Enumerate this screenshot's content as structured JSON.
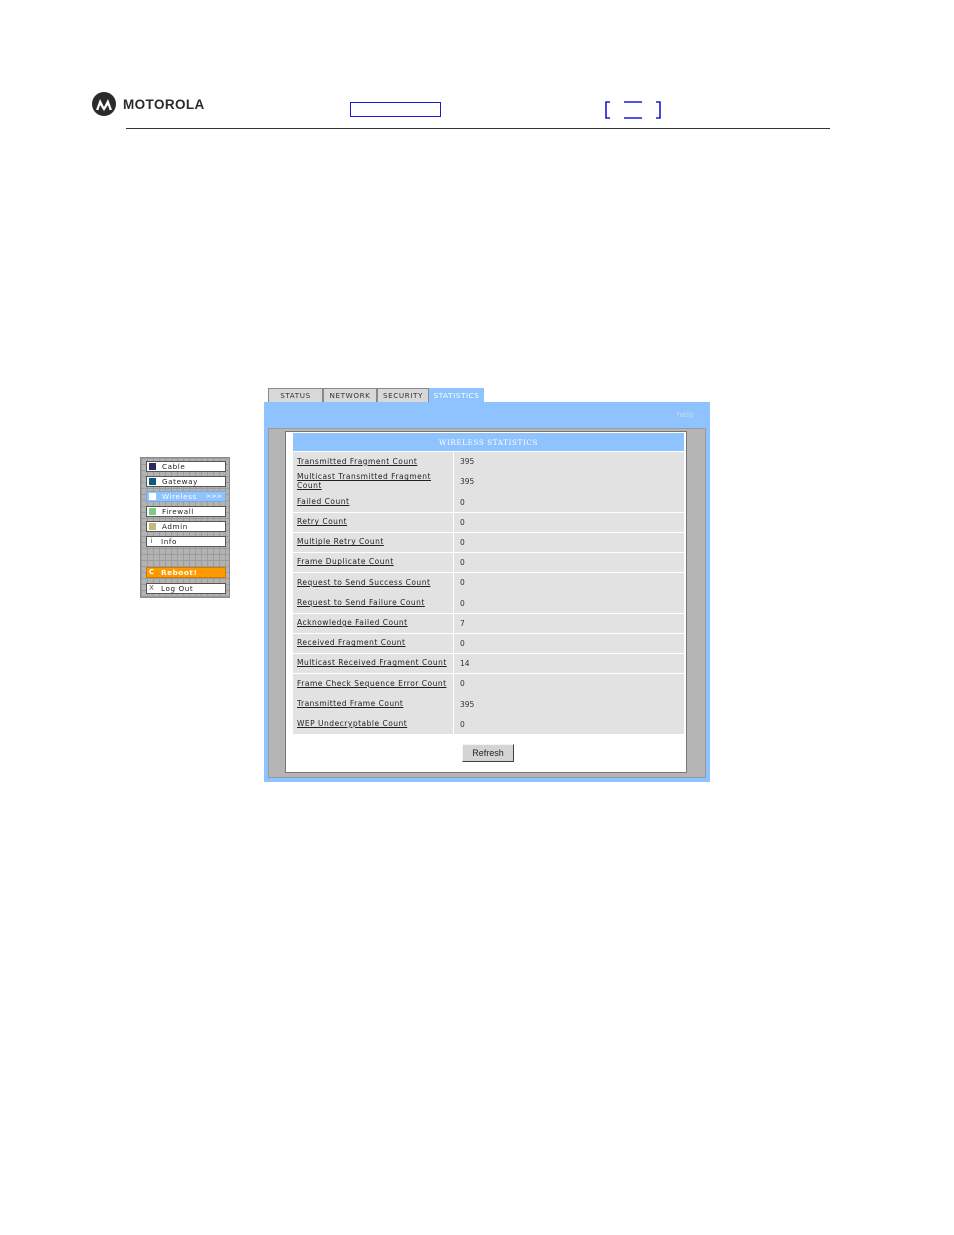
{
  "header": {
    "brand": "MOTOROLA"
  },
  "tabs": [
    {
      "label": "STATUS",
      "active": false
    },
    {
      "label": "NETWORK",
      "active": false
    },
    {
      "label": "SECURITY",
      "active": false
    },
    {
      "label": "STATISTICS",
      "active": true
    }
  ],
  "help_label": "help",
  "sidemenu": {
    "items": [
      {
        "label": "Cable",
        "icon": "square-icon",
        "color": "#2e2a5e"
      },
      {
        "label": "Gateway",
        "icon": "square-icon",
        "color": "#0d5a7a"
      },
      {
        "label": "Wireless",
        "icon": "square-icon",
        "color": "#ffffff",
        "active": true,
        "arrows": ">>>"
      },
      {
        "label": "Firewall",
        "icon": "square-icon",
        "color": "#7fc98a"
      },
      {
        "label": "Admin",
        "icon": "square-icon",
        "color": "#c8b97a"
      },
      {
        "label": "Info",
        "icon": "info-icon",
        "glyph": "i"
      },
      {
        "label": "Reboot!",
        "icon": "reboot-icon",
        "glyph": "C"
      },
      {
        "label": "Log Out",
        "icon": "close-icon",
        "glyph": "X"
      }
    ]
  },
  "stats": {
    "title": "WIRELESS STATISTICS",
    "rows": [
      {
        "label": "Transmitted Fragment Count",
        "value": "395"
      },
      {
        "label": "Multicast Transmitted Fragment Count",
        "value": "395"
      },
      {
        "label": "Failed Count",
        "value": "0"
      },
      {
        "label": "Retry Count",
        "value": "0"
      },
      {
        "label": "Multiple Retry Count",
        "value": "0"
      },
      {
        "label": "Frame Duplicate Count",
        "value": "0"
      },
      {
        "label": "Request to Send Success Count",
        "value": "0"
      },
      {
        "label": "Request to Send Failure Count",
        "value": "0"
      },
      {
        "label": "Acknowledge Failed Count",
        "value": "7"
      },
      {
        "label": "Received Fragment Count",
        "value": "0"
      },
      {
        "label": "Multicast Received Fragment Count",
        "value": "14"
      },
      {
        "label": "Frame Check Sequence Error Count",
        "value": "0"
      },
      {
        "label": "Transmitted Frame Count",
        "value": "395"
      },
      {
        "label": "WEP Undecryptable Count",
        "value": "0"
      }
    ],
    "refresh_label": "Refresh"
  },
  "colors": {
    "accent": "#8fc3ff",
    "reboot": "#ff9900",
    "row_bg": "#e2e2e2"
  }
}
